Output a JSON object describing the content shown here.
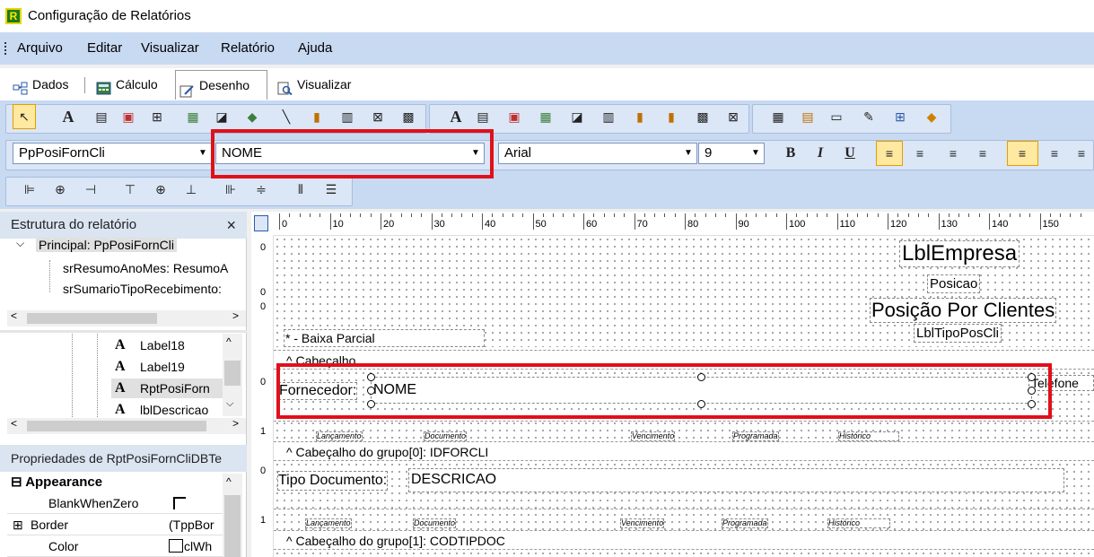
{
  "window": {
    "title": "Configuração de Relatórios",
    "app_icon_letter": "R"
  },
  "menu": [
    "Arquivo",
    "Editar",
    "Visualizar",
    "Relatório",
    "Ajuda"
  ],
  "tabs": [
    "Dados",
    "Cálculo",
    "Desenho",
    "Visualizar"
  ],
  "active_tab": "Desenho",
  "format_bar": {
    "component": "PpPosiFornCli",
    "field": "NOME",
    "font": "Arial",
    "font_size": "9",
    "bold": "B",
    "italic": "I",
    "underline": "U"
  },
  "tree_panel": {
    "title": "Estrutura do relatório",
    "close": "×",
    "root": "Principal: PpPosiFornCli",
    "children": [
      "srResumoAnoMes: ResumoA",
      "srSumarioTipoRecebimento:"
    ],
    "components": [
      "Label18",
      "Label19",
      "RptPosiForn",
      "lblDescricao"
    ]
  },
  "props_panel": {
    "title": "Propriedades de RptPosiFornCliDBTe",
    "category": "Appearance",
    "rows": [
      {
        "name": "BlankWhenZero",
        "value": ""
      },
      {
        "name": "Border",
        "value": "(TppBor"
      },
      {
        "name": "Color",
        "value": "clWh"
      }
    ]
  },
  "ruler": {
    "h_labels": [
      "0",
      "10",
      "20",
      "30",
      "40",
      "50",
      "60",
      "70",
      "80",
      "90",
      "100",
      "110",
      "120",
      "130",
      "140",
      "150"
    ],
    "v_labels": [
      "0",
      "0",
      "0",
      "0",
      "1",
      "0",
      "1"
    ]
  },
  "report": {
    "header_labels": {
      "company": "LblEmpresa",
      "posicao": "Posicao",
      "title": "Posição Por Clientes",
      "tipo": "LblTipoPosCli",
      "baixa": "* - Baixa Parcial"
    },
    "bands": [
      "Cabeçalho",
      "Cabeçalho do grupo[0]: IDFORCLI",
      "Cabeçalho do grupo[1]: CODTIPDOC"
    ],
    "fornecedor_label": "Fornecedor:",
    "fornecedor_field": "NOME",
    "telefone_label": "Telefone",
    "col_labels": [
      "Lançamento",
      "Documento",
      "Vencimento",
      "Programada",
      "Histórico"
    ],
    "tipo_doc_label": "Tipo Documento:",
    "tipo_doc_field": "DESCRICAO"
  },
  "colors": {
    "highlight": "#e0101a",
    "toolbar": "#c8d9f2"
  }
}
